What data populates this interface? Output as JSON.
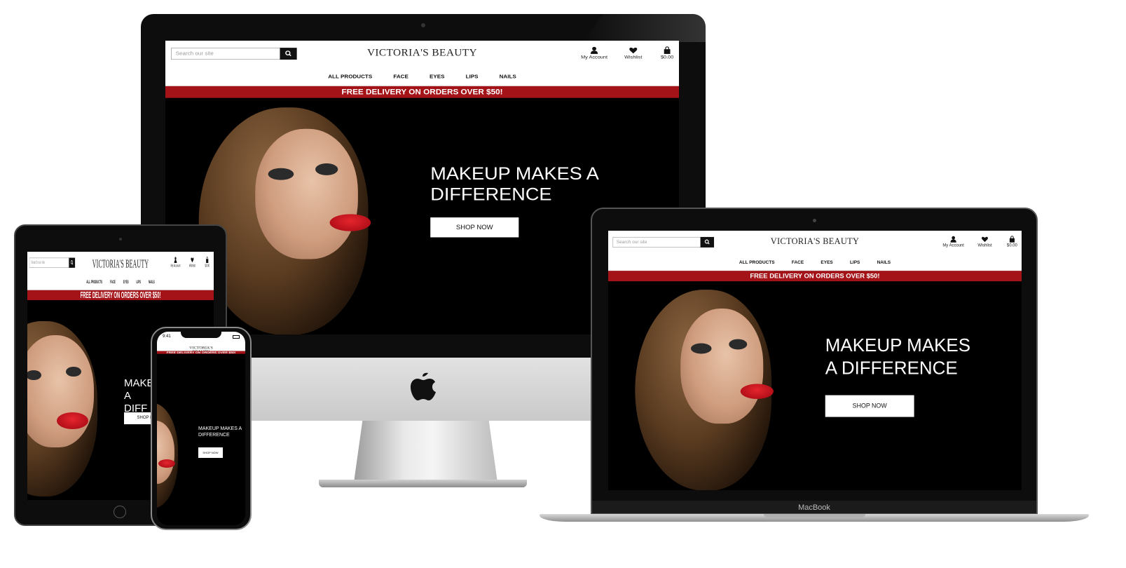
{
  "site": {
    "search_placeholder": "Search our site",
    "logo": "VICTORIA'S BEAUTY",
    "account_label": "My Account",
    "wishlist_label": "Wishlist",
    "cart_total": "$0.00",
    "nav": [
      "ALL PRODUCTS",
      "FACE",
      "EYES",
      "LIPS",
      "NAILS"
    ],
    "banner": "FREE DELIVERY ON ORDERS OVER $50!",
    "headline_desktop": "MAKEUP MAKES A DIFFERENCE",
    "headline_laptop": "MAKEUP MAKES A DIFFERENCE",
    "cta": "SHOP NOW"
  },
  "laptop_brand": "MacBook",
  "phone_status_time": "9:41",
  "tablet_headline_visible": "MAKE A DIFF",
  "tablet_cta_visible": "SHOP N",
  "colors": {
    "banner_red": "#a41318",
    "frame_black": "#0d0d0d",
    "imac_chin": "#d9d9d9"
  },
  "icons": {
    "search": "search-icon",
    "account": "user-icon",
    "wishlist": "heart-icon",
    "cart": "shopping-bag-icon",
    "apple": "apple-logo-icon"
  }
}
